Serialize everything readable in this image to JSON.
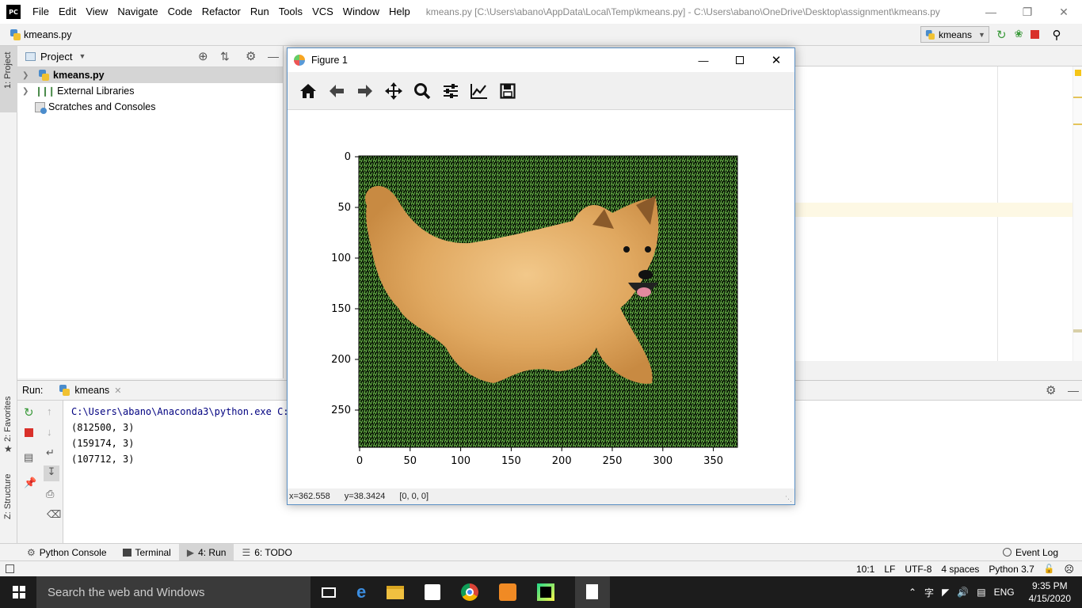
{
  "app": {
    "logo_text": "PC",
    "menu": [
      "File",
      "Edit",
      "View",
      "Navigate",
      "Code",
      "Refactor",
      "Run",
      "Tools",
      "VCS",
      "Window",
      "Help"
    ],
    "window_title": "kmeans.py [C:\\Users\\abano\\AppData\\Local\\Temp\\kmeans.py] - C:\\Users\\abano\\OneDrive\\Desktop\\assignment\\kmeans.py"
  },
  "navbar": {
    "file": "kmeans.py",
    "run_config": "kmeans"
  },
  "side_tabs": {
    "project": "1: Project",
    "favorites": "2: Favorites",
    "structure": "Z: Structure"
  },
  "project": {
    "title": "Project",
    "items": [
      {
        "label": "kmeans.py",
        "selected": true
      },
      {
        "label": "External Libraries"
      },
      {
        "label": "Scratches and Consoles"
      }
    ]
  },
  "run": {
    "label": "Run:",
    "tab": "kmeans",
    "lines": [
      "C:\\Users\\abano\\Anaconda3\\python.exe C:/",
      "(812500, 3)",
      "(159174, 3)",
      "(107712, 3)"
    ]
  },
  "tooltabs": [
    {
      "label": "Python Console",
      "icon": "python-console-icon"
    },
    {
      "label": "Terminal",
      "icon": "terminal-icon"
    },
    {
      "label": "4: Run",
      "icon": "run-icon",
      "active": true
    },
    {
      "label": "6: TODO",
      "icon": "todo-icon"
    }
  ],
  "event_log": "Event Log",
  "status": {
    "position": "10:1",
    "line_sep": "LF",
    "encoding": "UTF-8",
    "indent": "4 spaces",
    "interpreter": "Python 3.7"
  },
  "figure": {
    "title": "Figure 1",
    "status_x": "x=362.558",
    "status_y": "y=38.3424",
    "status_val": "[0, 0, 0]",
    "x_ticks": [
      "0",
      "50",
      "100",
      "150",
      "200",
      "250",
      "300",
      "350"
    ],
    "y_ticks": [
      "0",
      "50",
      "100",
      "150",
      "200",
      "250"
    ]
  },
  "taskbar": {
    "search": "Search the web and Windows",
    "lang": "ENG",
    "time": "9:35 PM",
    "date": "4/15/2020"
  },
  "colors": {
    "accent": "#4a8ccc",
    "taskbar": "#1c1c1c",
    "grass": "#3f7a2e",
    "dog": "#e0a860"
  }
}
